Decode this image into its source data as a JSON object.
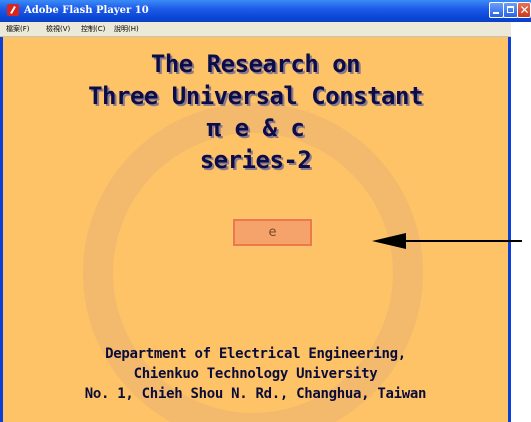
{
  "window": {
    "title": "Adobe Flash Player 10",
    "close_glyph": "✕"
  },
  "menu": {
    "items": [
      "檔案(F)",
      "檢視(V)",
      "控制(C)",
      "說明(H)"
    ]
  },
  "stage": {
    "heading_lines": [
      "The Research on",
      "Three Universal Constant",
      "π e & c",
      "series-2"
    ],
    "button_label": "e",
    "credit_lines": [
      "Department of Electrical Engineering,",
      "Chienkuo Technology University",
      "No. 1, Chieh Shou N. Rd., Changhua, Taiwan"
    ]
  },
  "colors": {
    "stage_bg": "#fdc366",
    "ring": "#f3b96c",
    "button_fill": "#f5a26b",
    "button_border": "#f07a3e",
    "text_dark": "#0c0c4a",
    "titlebar_blue": "#0a46d6"
  },
  "icons": {
    "app": "flash-player-icon",
    "minimize": "minimize-icon",
    "maximize": "maximize-icon",
    "close": "close-icon",
    "pointer": "arrow-left-icon"
  }
}
